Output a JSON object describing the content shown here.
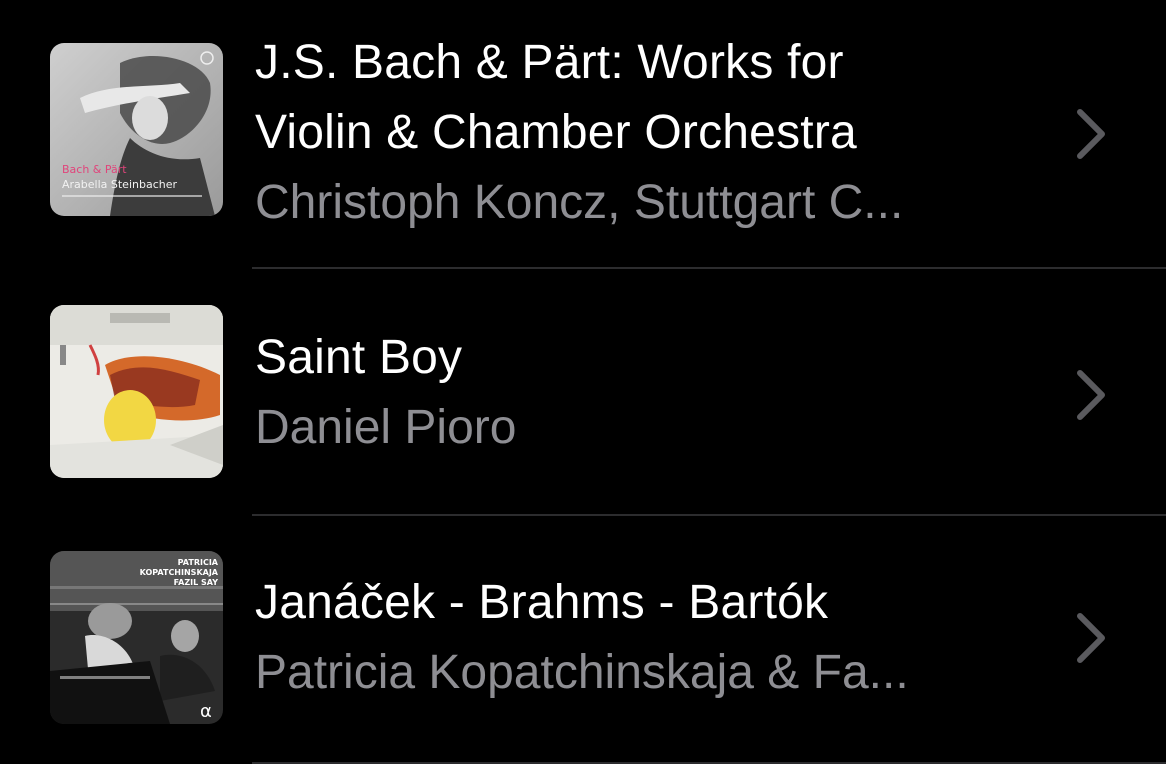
{
  "albums": [
    {
      "title_line1": "J.S. Bach & Pärt: Works for",
      "title_line2": "Violin & Chamber Orchestra",
      "subtitle": "Christoph Koncz, Stuttgart C...",
      "cover_text_line1": "Bach & Pärt",
      "cover_text_line2": "Arabella Steinbacher"
    },
    {
      "title_line1": "Saint Boy",
      "subtitle": "Daniel Pioro"
    },
    {
      "title_line1": "Janáček - Brahms - Bartók",
      "subtitle": "Patricia Kopatchinskaja & Fa...",
      "cover_text_line1": "PATRICIA",
      "cover_text_line2": "KOPATCHINSKAJA",
      "cover_text_line3": "FAZIL SAY",
      "cover_logo": "α"
    }
  ],
  "icons": {
    "chevron": "chevron-right-icon"
  },
  "colors": {
    "background": "#000000",
    "title": "#ffffff",
    "subtitle": "#8e8e93",
    "chevron": "#5a5a5e",
    "separator": "#2c2c2e",
    "accent_pink": "#e0457b"
  }
}
